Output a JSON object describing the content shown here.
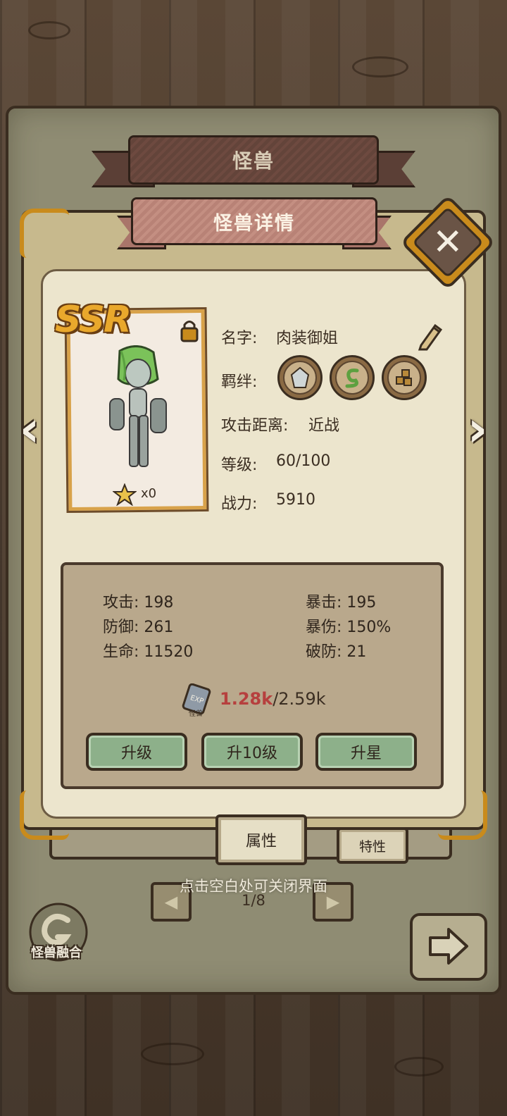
{
  "header": {
    "back_title": "怪兽",
    "title": "怪兽详情"
  },
  "monster": {
    "rarity": "SSR",
    "star_count": "x0",
    "name_label": "名字:",
    "name_value": "肉装御姐",
    "bond_label": "羁绊:",
    "bonds": [
      "crystal-icon",
      "snake-icon",
      "cubes-icon"
    ],
    "range_label": "攻击距离:",
    "range_value": "近战",
    "level_label": "等级:",
    "level_value": "60/100",
    "power_label": "战力:",
    "power_value": "5910"
  },
  "stats": {
    "attack": "攻击: 198",
    "defense": "防御: 261",
    "hp": "生命: 11520",
    "crit": "暴击: 195",
    "crit_dmg": "暴伤: 150%",
    "armor_break": "破防: 21"
  },
  "exp": {
    "icon_label": "怪兽",
    "current": "1.28k",
    "max": "/2.59k"
  },
  "buttons": {
    "level_up": "升级",
    "level_up_10": "升10级",
    "star_up": "升星"
  },
  "tabs": {
    "attributes": "属性",
    "traits": "特性"
  },
  "footer": {
    "close_hint": "点击空白处可关闭界面",
    "page": "1/8",
    "fusion_label": "怪兽融合"
  },
  "colors": {
    "accent_gold": "#c98b1c",
    "button_green": "#8db08a",
    "exp_red": "#b6403e"
  }
}
